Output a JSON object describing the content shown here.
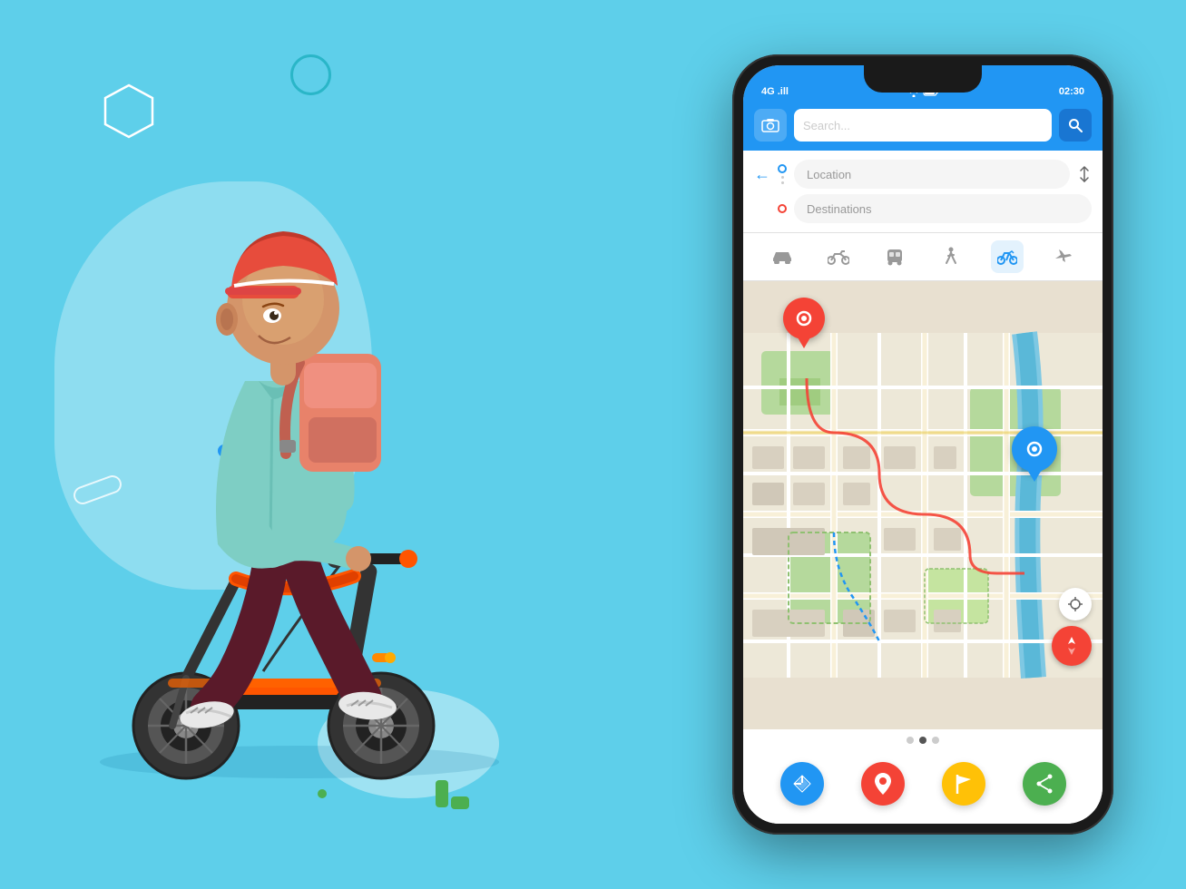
{
  "background": {
    "color": "#5ecfea"
  },
  "decorative": {
    "shapes": [
      "hexagon",
      "circle",
      "triangle",
      "rectangle"
    ],
    "dots": [
      "blue",
      "green"
    ],
    "dashes": [
      "yellow",
      "green"
    ]
  },
  "phone": {
    "status_bar": {
      "left": "4G .ill",
      "right": "02:30",
      "signal_icons": "wifi battery"
    },
    "search": {
      "placeholder": "Search..."
    },
    "location_fields": {
      "from_placeholder": "Location",
      "to_placeholder": "Destinations"
    },
    "transport_modes": [
      "car",
      "motorbike",
      "bus",
      "walk",
      "bicycle",
      "other"
    ],
    "active_transport": "bicycle",
    "map": {
      "pins": [
        {
          "type": "red",
          "label": "origin"
        },
        {
          "type": "blue",
          "label": "destination"
        }
      ],
      "route_color": "#f44336"
    },
    "bottom_toolbar": {
      "buttons": [
        {
          "icon": "directions",
          "color": "#2196f3",
          "label": "Navigate"
        },
        {
          "icon": "pin",
          "color": "#f44336",
          "label": "Pin"
        },
        {
          "icon": "flag",
          "color": "#ffc107",
          "label": "Flag"
        },
        {
          "icon": "share",
          "color": "#4caf50",
          "label": "Share"
        }
      ]
    }
  }
}
